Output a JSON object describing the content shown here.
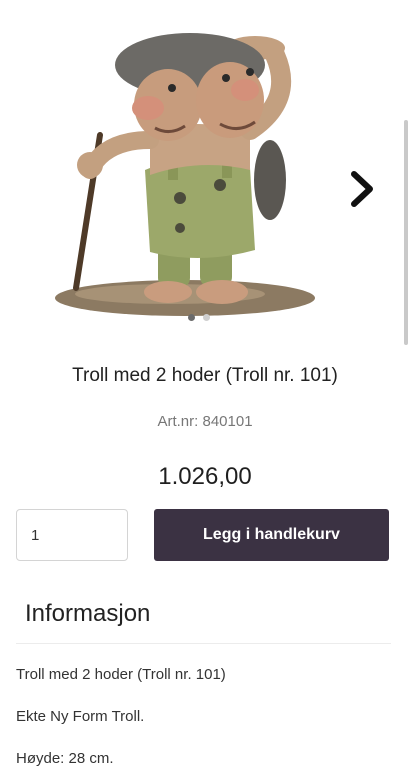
{
  "product": {
    "title": "Troll med 2 hoder (Troll nr. 101)",
    "article_number": "Art.nr: 840101",
    "price": "1.026,00",
    "image_icon": "two-headed-troll-figure"
  },
  "gallery": {
    "next_icon": "chevron-right-icon",
    "dots_count": 2,
    "active_dot": 0
  },
  "cart": {
    "quantity_value": "1",
    "add_button_label": "Legg i handlekurv"
  },
  "info": {
    "heading": "Informasjon",
    "lines": [
      "Troll med 2 hoder (Troll nr. 101)",
      "Ekte Ny Form Troll.",
      "Høyde: 28 cm."
    ]
  },
  "colors": {
    "button_bg": "#3b3243",
    "button_text": "#ffffff"
  }
}
